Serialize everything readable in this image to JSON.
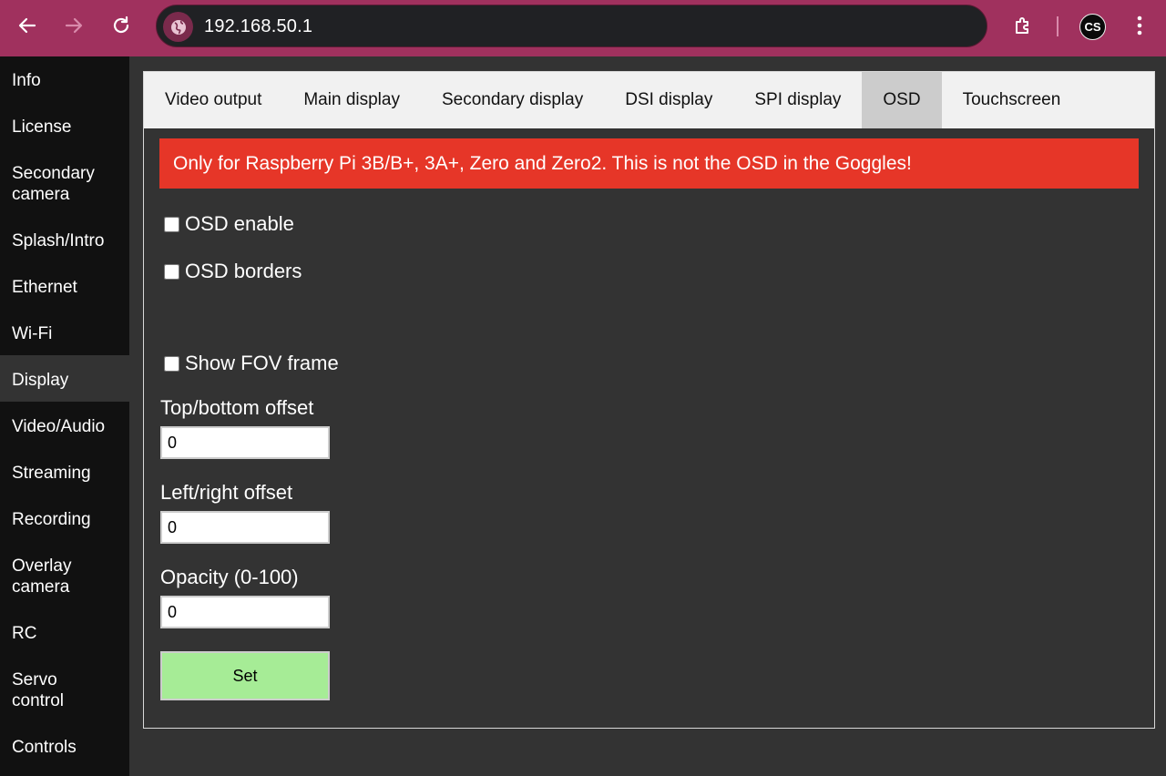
{
  "browser": {
    "url": "192.168.50.1",
    "profile_initials": "CS",
    "nav_icons": [
      "back-arrow-icon",
      "forward-arrow-icon",
      "reload-icon"
    ],
    "toolbar_icons": [
      "extensions-icon",
      "more-menu-icon"
    ]
  },
  "sidebar": {
    "items": [
      {
        "label": "Info"
      },
      {
        "label": "License"
      },
      {
        "label": "Secondary camera"
      },
      {
        "label": "Splash/Intro"
      },
      {
        "label": "Ethernet"
      },
      {
        "label": "Wi-Fi"
      },
      {
        "label": "Display",
        "active": true
      },
      {
        "label": "Video/Audio"
      },
      {
        "label": "Streaming"
      },
      {
        "label": "Recording"
      },
      {
        "label": "Overlay camera"
      },
      {
        "label": "RC"
      },
      {
        "label": "Servo control"
      },
      {
        "label": "Controls"
      }
    ]
  },
  "tabs": [
    {
      "label": "Video output"
    },
    {
      "label": "Main display"
    },
    {
      "label": "Secondary display"
    },
    {
      "label": "DSI display"
    },
    {
      "label": "SPI display"
    },
    {
      "label": "OSD",
      "active": true
    },
    {
      "label": "Touchscreen"
    }
  ],
  "warning": "Only for Raspberry Pi 3B/B+, 3A+, Zero and Zero2. This is not the OSD in the Goggles!",
  "form": {
    "osd_enable_label": "OSD enable",
    "osd_borders_label": "OSD borders",
    "show_fov_label": "Show FOV frame",
    "top_bottom_label": "Top/bottom offset",
    "top_bottom_value": "0",
    "left_right_label": "Left/right offset",
    "left_right_value": "0",
    "opacity_label": "Opacity (0-100)",
    "opacity_value": "0",
    "set_label": "Set"
  },
  "colors": {
    "chrome": "#a0315e",
    "warning": "#e63628",
    "set_button": "#a6ec96"
  }
}
